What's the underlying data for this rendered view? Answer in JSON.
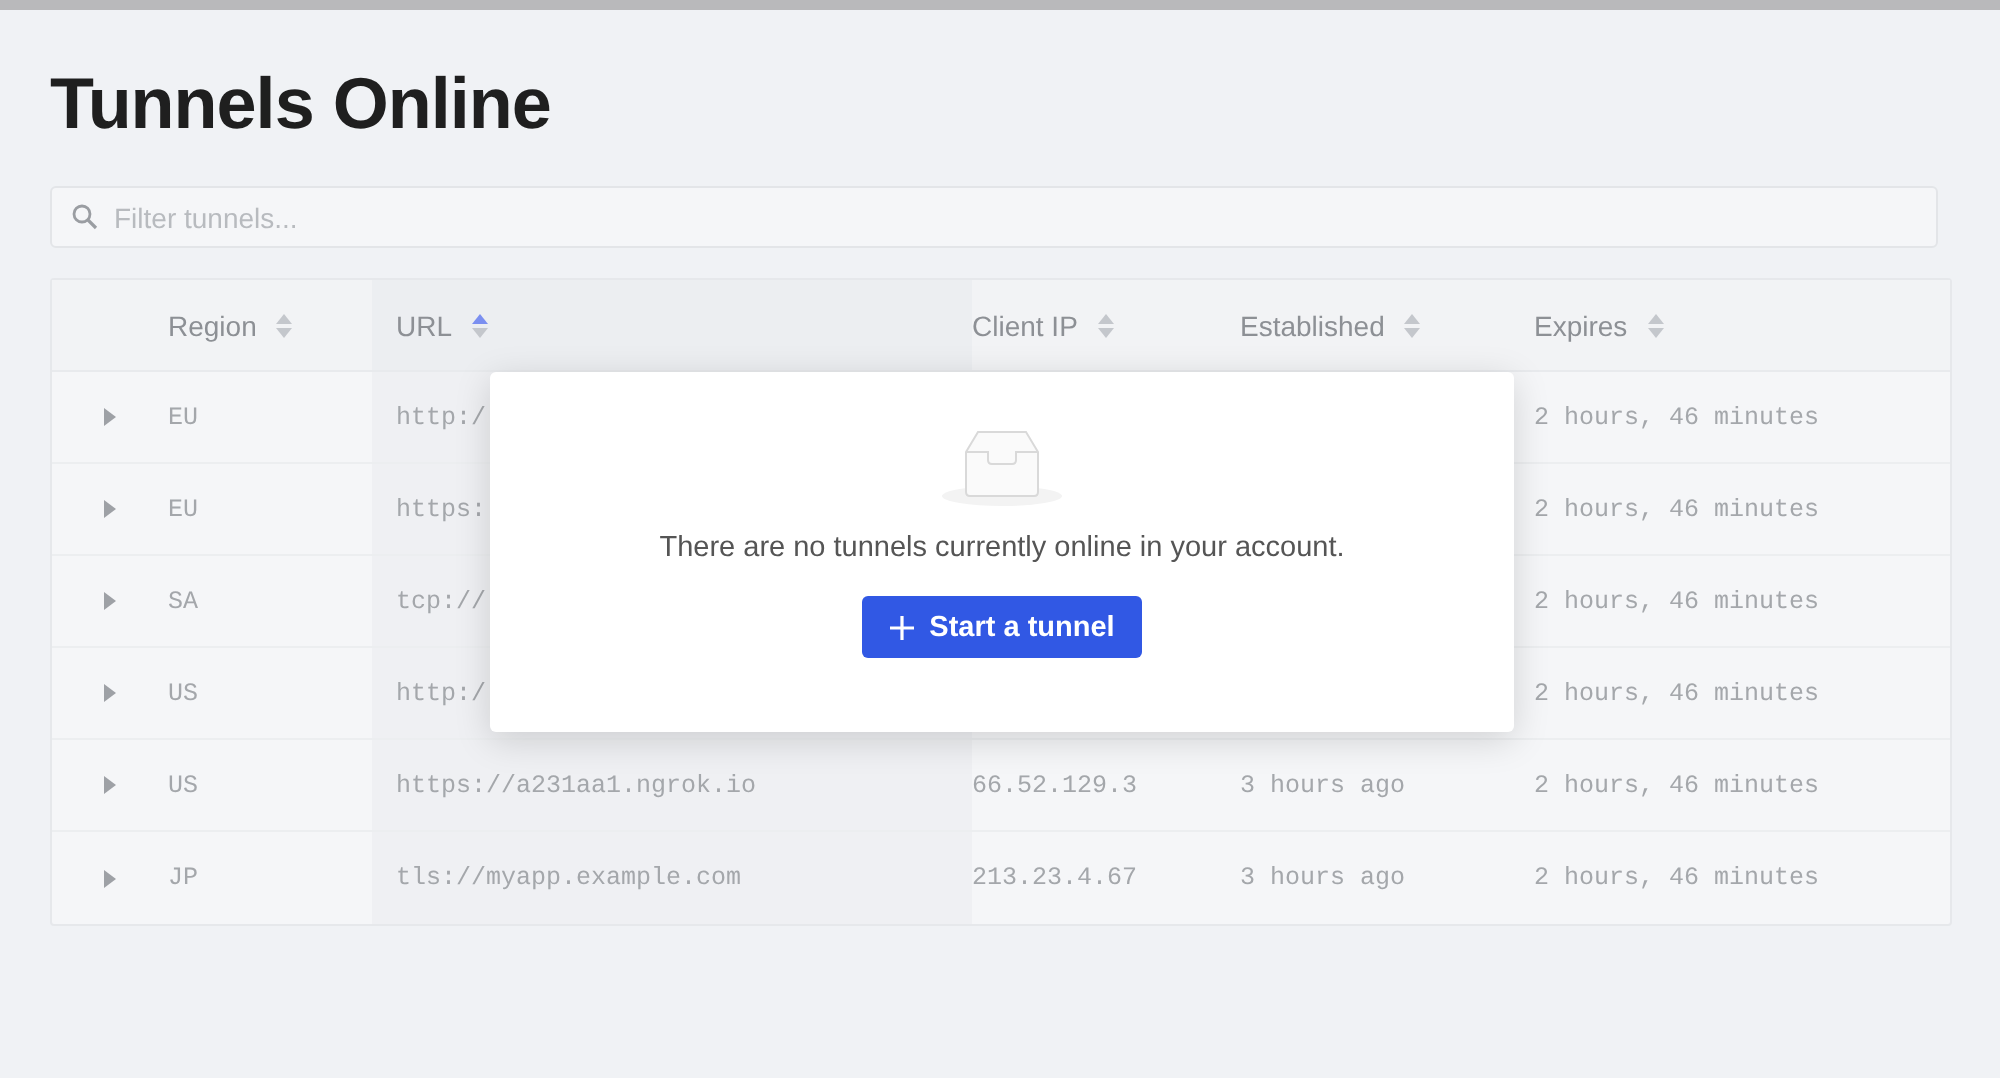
{
  "title": "Tunnels Online",
  "filter": {
    "placeholder": "Filter tunnels..."
  },
  "table": {
    "columns": [
      {
        "label": "Region",
        "sorted": false
      },
      {
        "label": "URL",
        "sorted": true
      },
      {
        "label": "Client IP",
        "sorted": false
      },
      {
        "label": "Established",
        "sorted": false
      },
      {
        "label": "Expires",
        "sorted": false
      }
    ],
    "rows": [
      {
        "expanded": false,
        "region": "EU",
        "url": "http:/",
        "expires": "2 hours, 46 minutes"
      },
      {
        "expanded": false,
        "region": "EU",
        "url": "https:",
        "expires": "2 hours, 46 minutes"
      },
      {
        "expanded": false,
        "region": "SA",
        "url": "tcp://",
        "expires": "2 hours, 46 minutes"
      },
      {
        "expanded": false,
        "region": "US",
        "url": "http:/",
        "expires": "2 hours, 46 minutes"
      },
      {
        "expanded": false,
        "region": "US",
        "url": "https://a231aa1.ngrok.io",
        "client_ip": "66.52.129.3",
        "established": "3 hours ago",
        "expires": "2 hours, 46 minutes"
      },
      {
        "expanded": false,
        "region": "JP",
        "url": "tls://myapp.example.com",
        "client_ip": "213.23.4.67",
        "established": "3 hours ago",
        "expires": "2 hours, 46 minutes"
      }
    ]
  },
  "empty_state": {
    "message": "There are no tunnels currently online in your account.",
    "button": "Start a tunnel"
  }
}
